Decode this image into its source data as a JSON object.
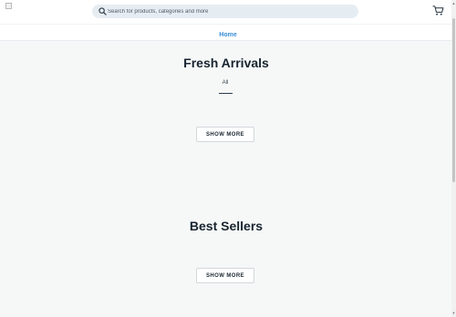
{
  "header": {
    "logo": "logo-image",
    "search": {
      "placeholder": "Search for products, categories and more",
      "value": "",
      "icon": "search-icon"
    },
    "cart_icon": "cart-icon"
  },
  "nav": {
    "home_label": "Home"
  },
  "fresh_arrivals": {
    "title": "Fresh Arrivals",
    "tabs": [
      {
        "label": "All",
        "active": true
      }
    ],
    "show_more_label": "SHOW MORE"
  },
  "best_sellers": {
    "title": "Best Sellers",
    "show_more_label": "SHOW MORE"
  },
  "colors": {
    "accent": "#3a8dd6",
    "background": "#f6f8f8",
    "search_bg": "#e6edf2",
    "text": "#17242f"
  }
}
